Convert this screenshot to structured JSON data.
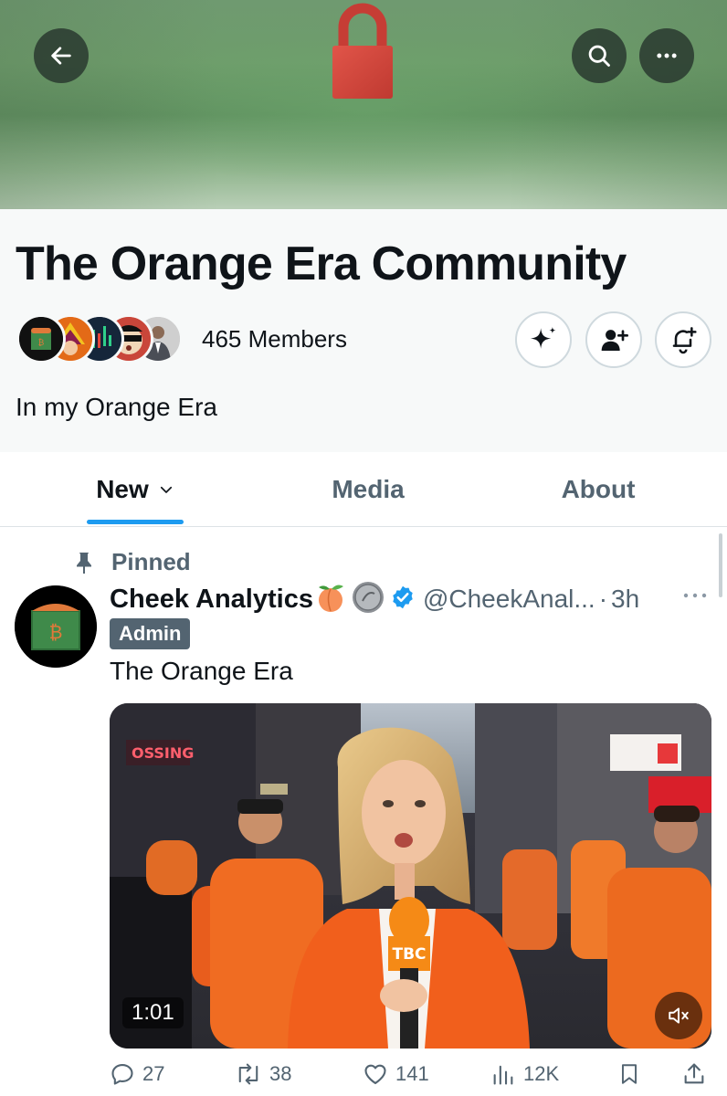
{
  "header": {
    "back_icon": "arrow-left-icon",
    "search_icon": "search-icon",
    "more_icon": "more-horizontal-icon",
    "banner_image": "red-padlock-on-green"
  },
  "community": {
    "title": "The Orange Era Community",
    "members_label": "465 Members",
    "description": "In my Orange Era",
    "actions": [
      "sparkle-icon",
      "add-member-icon",
      "notification-bell-icon"
    ]
  },
  "tabs": [
    {
      "label": "New",
      "active": true,
      "icon": "chevron-down-icon"
    },
    {
      "label": "Media",
      "active": false
    },
    {
      "label": "About",
      "active": false
    }
  ],
  "post": {
    "pinned_label": "Pinned",
    "author_name": "Cheek Analytics",
    "author_emoji": "🍑",
    "handle": "@CheekAnal...",
    "separator": "·",
    "time": "3h",
    "badge": "Admin",
    "text": "The Orange Era",
    "video": {
      "duration": "1:01",
      "mic_label": "TBC",
      "mute_icon": "speaker-muted-icon"
    },
    "stats": {
      "replies": "27",
      "reposts": "38",
      "likes": "141",
      "views": "12K"
    }
  },
  "colors": {
    "accent": "#1d9bf0",
    "text_secondary": "#536471",
    "badge_bg": "#536471",
    "verified": "#1d9bf0"
  }
}
